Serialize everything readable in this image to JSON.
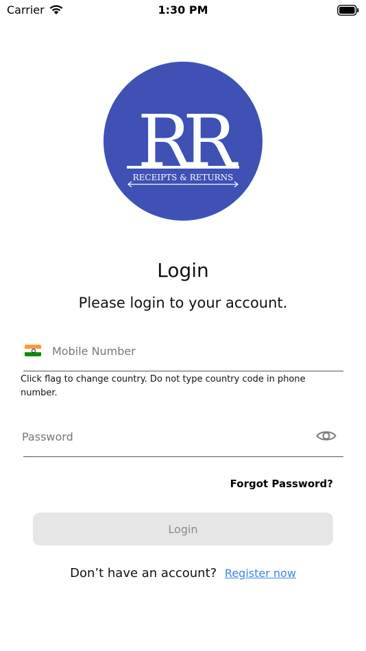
{
  "status_bar": {
    "carrier": "Carrier",
    "time": "1:30 PM"
  },
  "logo": {
    "monogram": "RR",
    "wordmark": "RECEIPTS & RETURNS",
    "color": "#3f51b5"
  },
  "login": {
    "title": "Login",
    "subtitle": "Please login to your account."
  },
  "mobile": {
    "flag_icon": "india-flag-icon",
    "placeholder": "Mobile Number",
    "value": "",
    "help_text": "Click flag to change country. Do not type country code in phone number."
  },
  "password": {
    "placeholder": "Password",
    "value": "",
    "visibility_icon": "eye-icon"
  },
  "forgot_password": "Forgot Password?",
  "login_button": "Login",
  "register": {
    "prompt": "Don’t have an account?",
    "link": "Register now",
    "link_color": "#3b86e8"
  }
}
